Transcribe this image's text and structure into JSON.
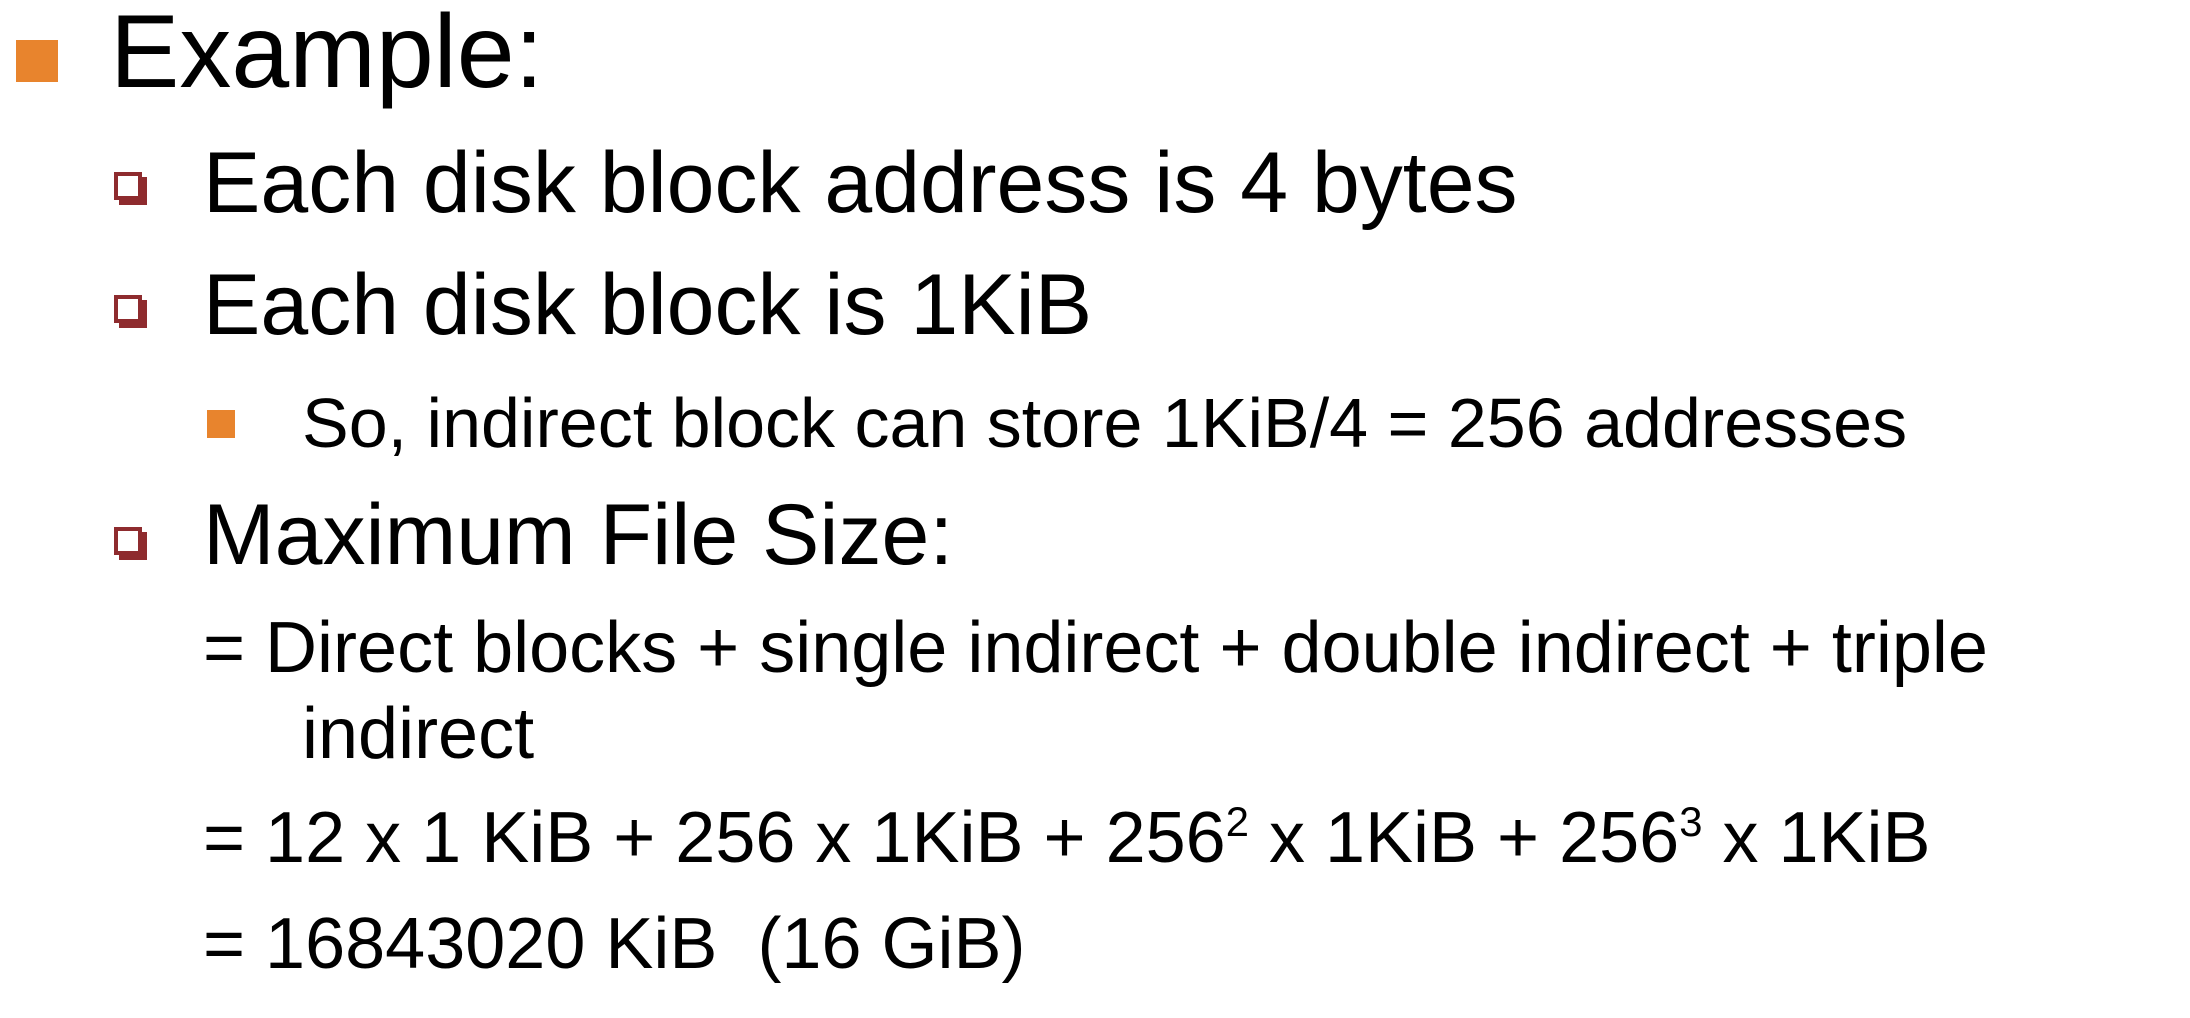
{
  "colors": {
    "level1_bullet": "#E8842D",
    "level2_bullet": "#8E2B2E",
    "level3_bullet": "#E8842D",
    "text": "#000000",
    "background": "#ffffff"
  },
  "heading": {
    "bullet_icon": "square-bullet-icon",
    "text": "Example:"
  },
  "points": [
    {
      "bullet_icon": "hollow-square-bullet-icon",
      "text": "Each disk block address is 4 bytes"
    },
    {
      "bullet_icon": "hollow-square-bullet-icon",
      "text": "Each disk block is 1KiB"
    },
    {
      "bullet_icon": "hollow-square-bullet-icon",
      "text": "Maximum File Size:"
    }
  ],
  "subpoint": {
    "bullet_icon": "square-bullet-icon",
    "text": "So, indirect block can store 1KiB/4 = 256 addresses"
  },
  "formula": {
    "line1": "= Direct blocks + single indirect + double indirect + triple",
    "line1_continuation": "indirect",
    "line2": {
      "part1": "= 12 x 1 KiB + 256 x 1KiB + 256",
      "exp1": "2",
      "part2": " x 1KiB + 256",
      "exp2": "3",
      "part3": " x 1KiB"
    },
    "line3": "= 16843020 KiB  (16 GiB)"
  }
}
